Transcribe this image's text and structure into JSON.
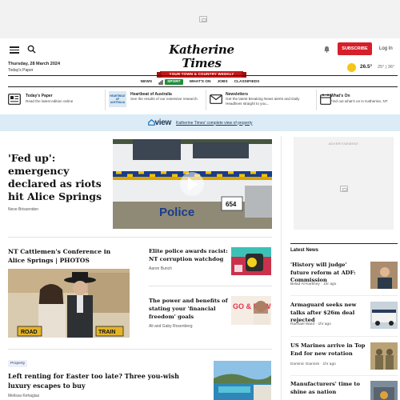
{
  "header": {
    "date": "Thursday, 28 March 2024",
    "todays_paper": "Today's Paper",
    "logo_title": "Katherine Times",
    "logo_tagline": "YOUR TOWN & COUNTRY WEEKLY",
    "subscribe": "SUBSCRIBE",
    "login": "Log In",
    "weather_now": "26.5°",
    "weather_range": "25° | 36°"
  },
  "nav": {
    "items": [
      "NEWS",
      "SPORT",
      "WHAT'S ON",
      "JOBS",
      "CLASSIFIEDS"
    ],
    "sport_color": "#1f8f3a"
  },
  "promos": [
    {
      "title": "Today's Paper",
      "desc": "Read the latest edition online",
      "icon": "newspaper-icon"
    },
    {
      "title": "Heartbeat of Australia",
      "desc": "See the results of our extensive research.",
      "icon": "heartbeat-logo",
      "logo_text": "HEARTBEAT OF AUSTRALIA"
    },
    {
      "title": "Newsletters",
      "desc": "Get the latest Breaking News alerts and Daily Headlines straight to you...",
      "icon": "envelope-icon"
    },
    {
      "title": "What's On",
      "desc": "Find out what's on in Katherine, NT",
      "icon": "calendar-icon"
    }
  ],
  "banner": {
    "logo": "view",
    "text": "Katherine Times' complete view of property"
  },
  "lead": {
    "title": "'Fed up': emergency declared as riots hit Alice Springs",
    "author": "Neve Brissenden",
    "image_text": "Police",
    "plate": "654"
  },
  "stories": [
    {
      "title": "NT Cattlemen's Conference in Alice Springs | PHOTOS",
      "author": "",
      "image_signs": [
        "ROAD",
        "TRAIN"
      ]
    },
    {
      "title": "Elite police awards racist: NT corruption watchdog",
      "author": "Aaron Bunch"
    },
    {
      "title": "The power and benefits of stating your 'financial freedom' goals",
      "author": "Ali and Gaby Rosenberg",
      "image_text": "GO & ROW"
    },
    {
      "tag": "Property",
      "title": "Left renting for Easter too late? Three you-wish luxury escapes to buy",
      "author": "Melissa Kehagias"
    }
  ],
  "sidebar": {
    "ad_label": "ADVERTISEMENT",
    "latest_heading": "Latest News",
    "latest": [
      {
        "title": "'History will judge' future reform at ADF: Commission",
        "author": "Belad Al-Karkhey",
        "time": "1hr ago"
      },
      {
        "title": "Armaguard seeks new talks after $26m deal rejected",
        "author": "Rachael Ward",
        "time": "1hr ago"
      },
      {
        "title": "US Marines arrive in Top End for new rotation",
        "author": "Dominic Giannini",
        "time": "1hr ago"
      },
      {
        "title": "Manufacturers' time to shine as nation",
        "author": "",
        "time": ""
      }
    ]
  },
  "colors": {
    "accent_red": "#d51f2b",
    "sport_green": "#1f8f3a",
    "banner_bg": "#dcecf6"
  }
}
